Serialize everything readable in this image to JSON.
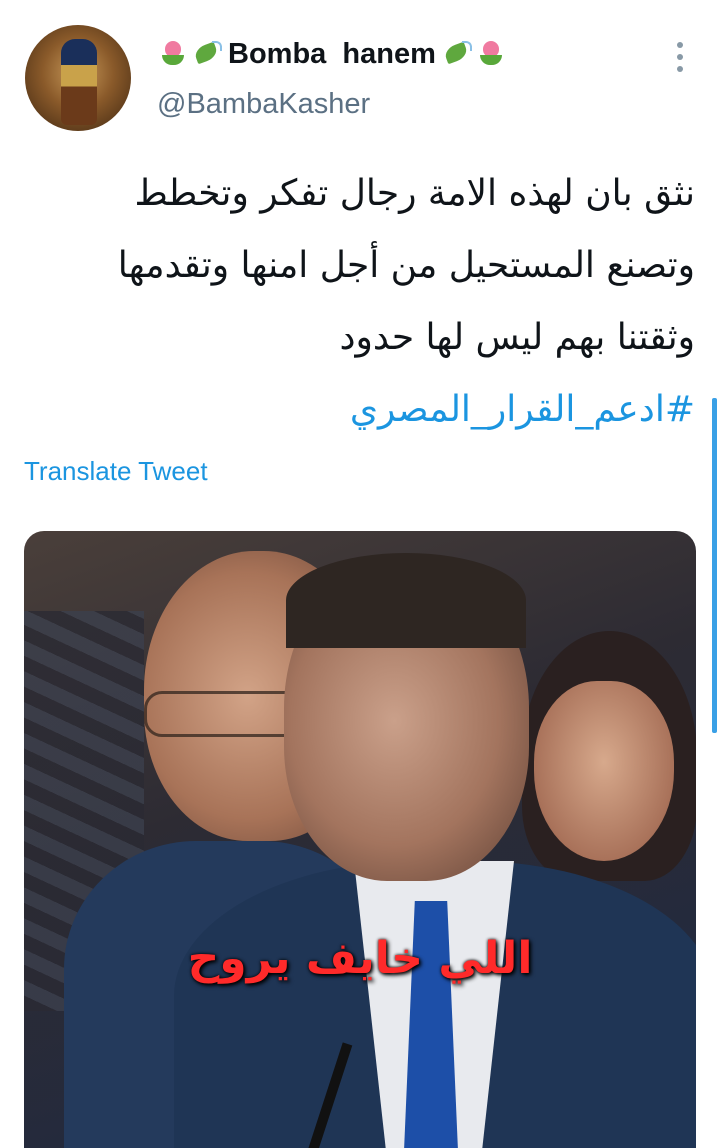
{
  "tweet": {
    "author": {
      "display_name": "Bomba  hanem",
      "handle": "@BambaKasher",
      "avatar_icon": "avatar-image"
    },
    "text_lines": [
      "نثق بان لهذه الامة رجال تفكر وتخطط",
      "وتصنع المستحيل من أجل امنها وتقدمها",
      "وثقتنا بهم ليس لها حدود"
    ],
    "hashtag": "#ادعم_القرار_المصري",
    "translate_label": "Translate Tweet",
    "media": {
      "caption": "اللي خايف يروح"
    }
  },
  "colors": {
    "accent": "#1b95e0",
    "handle": "#5b7083",
    "caption": "#ff2a2a"
  },
  "icons": {
    "menu": "more-vertical-icon",
    "name_decor": [
      "tulip-icon",
      "leaf-icon",
      "leaf-icon",
      "tulip-icon"
    ]
  }
}
